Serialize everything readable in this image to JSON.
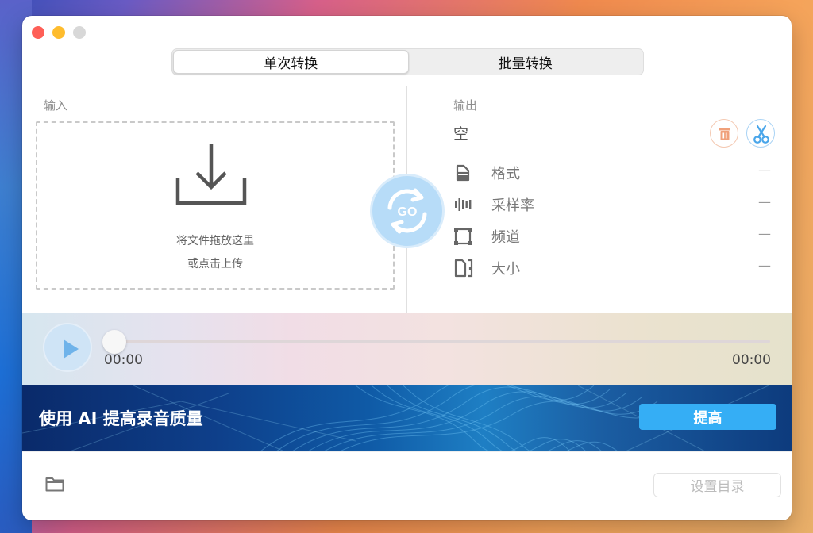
{
  "tabs": [
    {
      "label": "单次转换",
      "active": true
    },
    {
      "label": "批量转换",
      "active": false
    }
  ],
  "input": {
    "title": "输入",
    "drop_hint_line1": "将文件拖放这里",
    "drop_hint_line2": "或点击上传"
  },
  "go_button": {
    "label": "GO"
  },
  "output": {
    "title": "输出",
    "filename": "空",
    "properties": [
      {
        "icon": "file-icon",
        "label": "格式",
        "value": "—"
      },
      {
        "icon": "waveform-icon",
        "label": "采样率",
        "value": "—"
      },
      {
        "icon": "channel-icon",
        "label": "频道",
        "value": "—"
      },
      {
        "icon": "size-icon",
        "label": "大小",
        "value": "—"
      }
    ]
  },
  "player": {
    "current_time": "00:00",
    "total_time": "00:00",
    "progress": 0
  },
  "banner": {
    "title": "使用 AI 提高录音质量",
    "button_label": "提高"
  },
  "footer": {
    "set_directory_label": "设置目录"
  },
  "colors": {
    "accent_blue": "#35aef5",
    "go_blue": "#b7dcf8",
    "trash_orange": "#f0a07a",
    "cut_blue": "#4aa6ea"
  }
}
